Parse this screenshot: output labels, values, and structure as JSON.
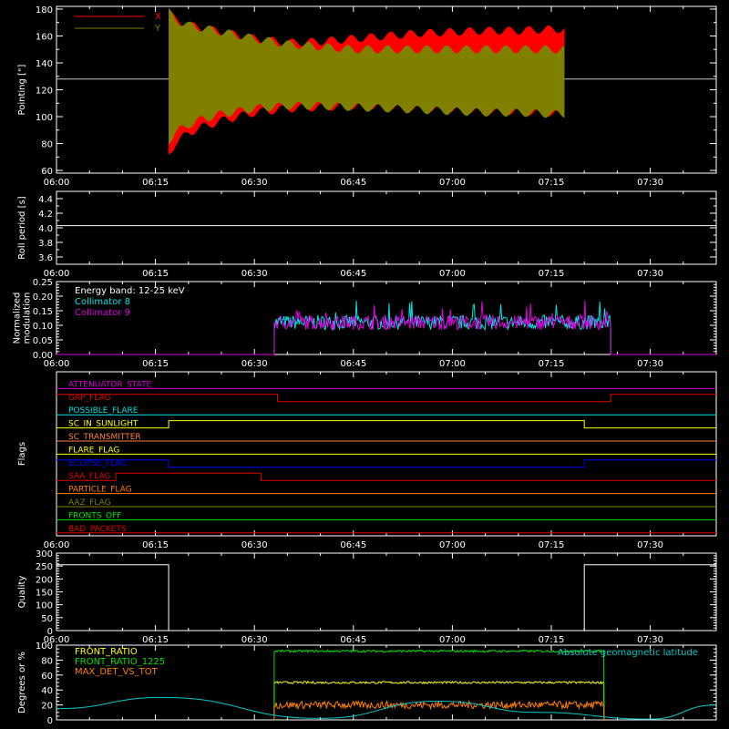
{
  "colors": {
    "background": "#000000",
    "axis": "#ffffff",
    "x_pointing": "#ff0000",
    "y_pointing": "#808000",
    "collimator8": "#00e5e5",
    "collimator9": "#e000e0",
    "front_ratio": "#ffff00",
    "front_ratio_1225": "#00e000",
    "max_det_vs_tot": "#ff8000",
    "geomag": "#00c8c8"
  },
  "time_ticks": [
    "06:00",
    "06:15",
    "06:30",
    "06:45",
    "07:00",
    "07:15",
    "07:30"
  ],
  "chart_data": [
    {
      "type": "area",
      "ylabel": "Pointing [\"]",
      "ylim": [
        58,
        182
      ],
      "yticks": [
        60,
        80,
        100,
        120,
        140,
        160,
        180
      ],
      "legend": {
        "placement": "top-left",
        "entries": [
          "X",
          "Y"
        ]
      },
      "x": [
        "06:17",
        "06:18",
        "06:20",
        "06:22",
        "06:25",
        "06:30",
        "06:35",
        "06:40",
        "06:45",
        "06:50",
        "06:55",
        "07:00",
        "07:05",
        "07:10",
        "07:15",
        "07:17"
      ],
      "series": [
        {
          "name": "X",
          "upper": [
            178,
            172,
            168,
            166,
            163,
            158,
            155,
            156,
            158,
            160,
            162,
            163,
            164,
            164,
            165,
            165
          ],
          "lower": [
            72,
            80,
            88,
            92,
            97,
            103,
            106,
            107,
            108,
            108,
            107,
            106,
            105,
            104,
            103,
            102
          ]
        },
        {
          "name": "Y",
          "upper": [
            178,
            172,
            168,
            166,
            163,
            158,
            154,
            152,
            150,
            150,
            150,
            150,
            150,
            150,
            150,
            150
          ],
          "lower": [
            82,
            88,
            94,
            98,
            102,
            106,
            108,
            108,
            107,
            106,
            105,
            104,
            103,
            103,
            102,
            102
          ]
        }
      ],
      "reference_level": 128
    },
    {
      "type": "line",
      "ylabel": "Roll period [s]",
      "ylim": [
        3.5,
        4.5
      ],
      "yticks": [
        "3.6",
        "3.8",
        "4.0",
        "4.2",
        "4.4"
      ],
      "value": 4.03
    },
    {
      "type": "line",
      "ylabel": "Normalized modulation",
      "ylim": [
        0,
        0.25
      ],
      "yticks": [
        "0.00",
        "0.05",
        "0.10",
        "0.15",
        "0.20",
        "0.25"
      ],
      "legend": {
        "placement": "top-left",
        "entries": [
          "Energy band: 12-25 keV",
          "Collimator 8",
          "Collimator 9"
        ]
      },
      "start": "06:33",
      "end": "07:24",
      "series": [
        {
          "name": "Collimator 8",
          "mean": 0.11
        },
        {
          "name": "Collimator 9",
          "mean": 0.11
        }
      ]
    },
    {
      "type": "table",
      "ylabel": "Flags",
      "flags": [
        {
          "name": "ATTENUATOR_STATE",
          "color": "#d000d0",
          "segments": [
            [
              0,
              0
            ]
          ]
        },
        {
          "name": "GAP_FLAG",
          "color": "#e00000",
          "segments": [
            [
              1,
              0,
              33.5
            ],
            [
              0,
              33.5,
              84
            ],
            [
              1,
              84,
              100
            ]
          ]
        },
        {
          "name": "POSSIBLE_FLARE",
          "color": "#00e0e0",
          "segments": [
            [
              0,
              0,
              100
            ]
          ]
        },
        {
          "name": "SC_IN_SUNLIGHT",
          "color": "#ffff00",
          "segments": [
            [
              0,
              0,
              17
            ],
            [
              1,
              17,
              80
            ],
            [
              0,
              80,
              100
            ]
          ]
        },
        {
          "name": "SC_TRANSMITTER",
          "color": "#ff8040",
          "segments": [
            [
              0,
              0,
              100
            ]
          ]
        },
        {
          "name": "FLARE_FLAG",
          "color": "#ffff00",
          "segments": [
            [
              0,
              0,
              100
            ]
          ]
        },
        {
          "name": "ECLIPSE_FLAG",
          "color": "#0000ff",
          "segments": [
            [
              1,
              0,
              17
            ],
            [
              0,
              17,
              80
            ],
            [
              1,
              80,
              100
            ]
          ]
        },
        {
          "name": "SAA_FLAG",
          "color": "#e00000",
          "segments": [
            [
              0,
              0,
              9
            ],
            [
              1,
              9,
              31
            ],
            [
              0,
              31,
              100
            ]
          ]
        },
        {
          "name": "PARTICLE_FLAG",
          "color": "#ff8000",
          "segments": [
            [
              0,
              0,
              100
            ]
          ]
        },
        {
          "name": "AAZ_FLAG",
          "color": "#808000",
          "segments": [
            [
              0,
              0,
              100
            ]
          ]
        },
        {
          "name": "FRONTS_OFF",
          "color": "#00e000",
          "segments": [
            [
              0,
              0,
              100
            ]
          ]
        },
        {
          "name": "BAD_PACKETS",
          "color": "#e00000",
          "segments": [
            [
              0,
              0,
              100
            ]
          ]
        }
      ]
    },
    {
      "type": "line",
      "ylabel": "Quality",
      "ylim": [
        0,
        300
      ],
      "yticks": [
        0,
        50,
        100,
        150,
        200,
        250,
        300
      ],
      "segments": [
        {
          "from": "06:00",
          "to": "06:17",
          "value": 255
        },
        {
          "from": "06:17",
          "to": "07:20",
          "value": 0
        },
        {
          "from": "07:20",
          "to": "07:40",
          "value": 255
        }
      ]
    },
    {
      "type": "line",
      "ylabel": "Degrees or %",
      "ylim": [
        0,
        100
      ],
      "yticks": [
        0,
        20,
        40,
        60,
        80,
        100
      ],
      "legend": {
        "placement": "top-left",
        "entries": [
          "FRONT_RATIO",
          "FRONT_RATIO_1225",
          "MAX_DET_VS_TOT"
        ]
      },
      "annotation": "Absolute geomagnetic latitude",
      "series": [
        {
          "name": "FRONT_RATIO",
          "start": "06:33",
          "end": "07:23",
          "mean": 50
        },
        {
          "name": "FRONT_RATIO_1225",
          "start": "06:33",
          "end": "07:23",
          "mean": 92
        },
        {
          "name": "MAX_DET_VS_TOT",
          "start": "06:33",
          "end": "07:23",
          "mean": 20
        },
        {
          "name": "Absolute geomagnetic latitude",
          "x": [
            "06:00",
            "06:16",
            "06:40",
            "06:58",
            "07:13",
            "07:30",
            "07:40"
          ],
          "y": [
            15,
            30,
            2,
            25,
            10,
            1,
            20
          ]
        }
      ]
    }
  ]
}
